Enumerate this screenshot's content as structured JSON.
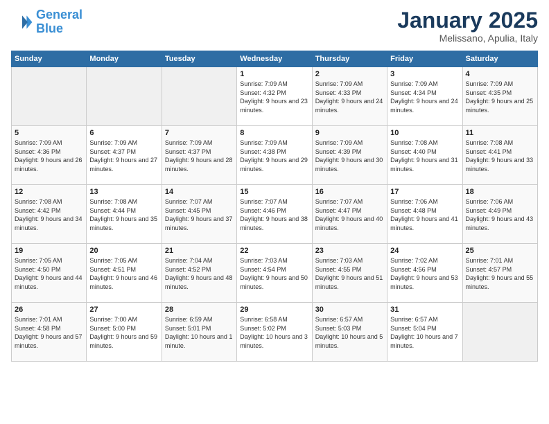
{
  "header": {
    "logo_line1": "General",
    "logo_line2": "Blue",
    "month": "January 2025",
    "location": "Melissano, Apulia, Italy"
  },
  "days_of_week": [
    "Sunday",
    "Monday",
    "Tuesday",
    "Wednesday",
    "Thursday",
    "Friday",
    "Saturday"
  ],
  "weeks": [
    [
      {
        "day": "",
        "info": ""
      },
      {
        "day": "",
        "info": ""
      },
      {
        "day": "",
        "info": ""
      },
      {
        "day": "1",
        "info": "Sunrise: 7:09 AM\nSunset: 4:32 PM\nDaylight: 9 hours and 23 minutes."
      },
      {
        "day": "2",
        "info": "Sunrise: 7:09 AM\nSunset: 4:33 PM\nDaylight: 9 hours and 24 minutes."
      },
      {
        "day": "3",
        "info": "Sunrise: 7:09 AM\nSunset: 4:34 PM\nDaylight: 9 hours and 24 minutes."
      },
      {
        "day": "4",
        "info": "Sunrise: 7:09 AM\nSunset: 4:35 PM\nDaylight: 9 hours and 25 minutes."
      }
    ],
    [
      {
        "day": "5",
        "info": "Sunrise: 7:09 AM\nSunset: 4:36 PM\nDaylight: 9 hours and 26 minutes."
      },
      {
        "day": "6",
        "info": "Sunrise: 7:09 AM\nSunset: 4:37 PM\nDaylight: 9 hours and 27 minutes."
      },
      {
        "day": "7",
        "info": "Sunrise: 7:09 AM\nSunset: 4:37 PM\nDaylight: 9 hours and 28 minutes."
      },
      {
        "day": "8",
        "info": "Sunrise: 7:09 AM\nSunset: 4:38 PM\nDaylight: 9 hours and 29 minutes."
      },
      {
        "day": "9",
        "info": "Sunrise: 7:09 AM\nSunset: 4:39 PM\nDaylight: 9 hours and 30 minutes."
      },
      {
        "day": "10",
        "info": "Sunrise: 7:08 AM\nSunset: 4:40 PM\nDaylight: 9 hours and 31 minutes."
      },
      {
        "day": "11",
        "info": "Sunrise: 7:08 AM\nSunset: 4:41 PM\nDaylight: 9 hours and 33 minutes."
      }
    ],
    [
      {
        "day": "12",
        "info": "Sunrise: 7:08 AM\nSunset: 4:42 PM\nDaylight: 9 hours and 34 minutes."
      },
      {
        "day": "13",
        "info": "Sunrise: 7:08 AM\nSunset: 4:44 PM\nDaylight: 9 hours and 35 minutes."
      },
      {
        "day": "14",
        "info": "Sunrise: 7:07 AM\nSunset: 4:45 PM\nDaylight: 9 hours and 37 minutes."
      },
      {
        "day": "15",
        "info": "Sunrise: 7:07 AM\nSunset: 4:46 PM\nDaylight: 9 hours and 38 minutes."
      },
      {
        "day": "16",
        "info": "Sunrise: 7:07 AM\nSunset: 4:47 PM\nDaylight: 9 hours and 40 minutes."
      },
      {
        "day": "17",
        "info": "Sunrise: 7:06 AM\nSunset: 4:48 PM\nDaylight: 9 hours and 41 minutes."
      },
      {
        "day": "18",
        "info": "Sunrise: 7:06 AM\nSunset: 4:49 PM\nDaylight: 9 hours and 43 minutes."
      }
    ],
    [
      {
        "day": "19",
        "info": "Sunrise: 7:05 AM\nSunset: 4:50 PM\nDaylight: 9 hours and 44 minutes."
      },
      {
        "day": "20",
        "info": "Sunrise: 7:05 AM\nSunset: 4:51 PM\nDaylight: 9 hours and 46 minutes."
      },
      {
        "day": "21",
        "info": "Sunrise: 7:04 AM\nSunset: 4:52 PM\nDaylight: 9 hours and 48 minutes."
      },
      {
        "day": "22",
        "info": "Sunrise: 7:03 AM\nSunset: 4:54 PM\nDaylight: 9 hours and 50 minutes."
      },
      {
        "day": "23",
        "info": "Sunrise: 7:03 AM\nSunset: 4:55 PM\nDaylight: 9 hours and 51 minutes."
      },
      {
        "day": "24",
        "info": "Sunrise: 7:02 AM\nSunset: 4:56 PM\nDaylight: 9 hours and 53 minutes."
      },
      {
        "day": "25",
        "info": "Sunrise: 7:01 AM\nSunset: 4:57 PM\nDaylight: 9 hours and 55 minutes."
      }
    ],
    [
      {
        "day": "26",
        "info": "Sunrise: 7:01 AM\nSunset: 4:58 PM\nDaylight: 9 hours and 57 minutes."
      },
      {
        "day": "27",
        "info": "Sunrise: 7:00 AM\nSunset: 5:00 PM\nDaylight: 9 hours and 59 minutes."
      },
      {
        "day": "28",
        "info": "Sunrise: 6:59 AM\nSunset: 5:01 PM\nDaylight: 10 hours and 1 minute."
      },
      {
        "day": "29",
        "info": "Sunrise: 6:58 AM\nSunset: 5:02 PM\nDaylight: 10 hours and 3 minutes."
      },
      {
        "day": "30",
        "info": "Sunrise: 6:57 AM\nSunset: 5:03 PM\nDaylight: 10 hours and 5 minutes."
      },
      {
        "day": "31",
        "info": "Sunrise: 6:57 AM\nSunset: 5:04 PM\nDaylight: 10 hours and 7 minutes."
      },
      {
        "day": "",
        "info": ""
      }
    ]
  ]
}
